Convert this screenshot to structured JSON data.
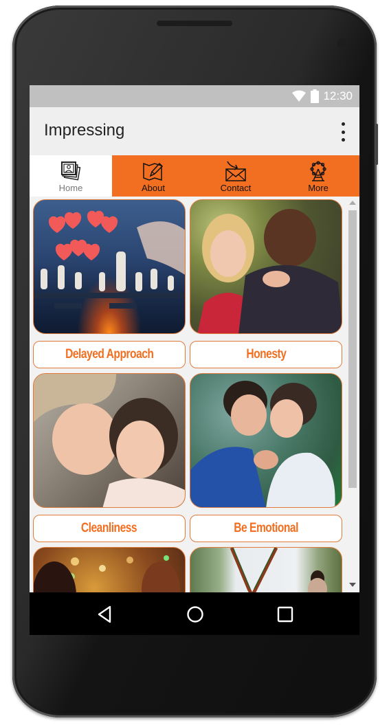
{
  "status_bar": {
    "time": "12:30",
    "icons": [
      "wifi-icon",
      "battery-icon"
    ]
  },
  "app_bar": {
    "title": "Impressing",
    "menu_icon": "more-vert-icon"
  },
  "tabs": [
    {
      "label": "Home",
      "icon": "photo-stack-icon",
      "active": true
    },
    {
      "label": "About",
      "icon": "map-pencil-icon",
      "active": false
    },
    {
      "label": "Contact",
      "icon": "envelope-arrow-icon",
      "active": false
    },
    {
      "label": "More",
      "icon": "ferris-wheel-icon",
      "active": false
    }
  ],
  "cards": [
    {
      "title": "Delayed Approach",
      "image": "chess-hearts-photo"
    },
    {
      "title": "Honesty",
      "image": "couple-embrace-photo"
    },
    {
      "title": "Cleanliness",
      "image": "couple-cuddle-photo"
    },
    {
      "title": "Be Emotional",
      "image": "couple-forehead-photo"
    },
    {
      "title": "",
      "image": "couple-bokeh-photo"
    },
    {
      "title": "",
      "image": "man-suspenders-photo"
    }
  ],
  "nav_bar": {
    "buttons": [
      "back-button",
      "home-button",
      "recents-button"
    ]
  },
  "colors": {
    "accent": "#f26f21",
    "caption_border": "#e07a3a",
    "status_bar": "#c0c0c0",
    "app_bar": "#efefef"
  }
}
